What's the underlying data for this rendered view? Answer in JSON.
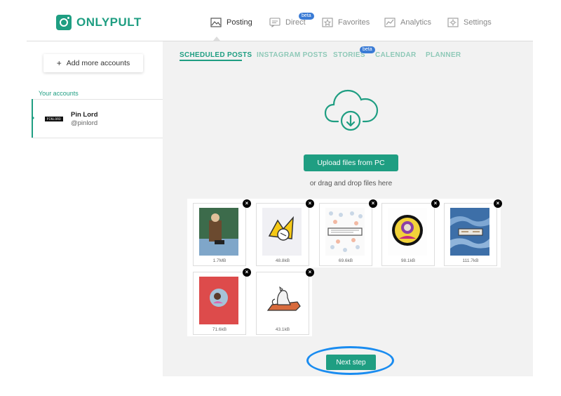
{
  "brand": {
    "name": "ONLYPULT",
    "color": "#1f9e82"
  },
  "nav": {
    "items": [
      {
        "label": "Posting",
        "icon": "image-icon",
        "active": true
      },
      {
        "label": "Direct",
        "icon": "chat-icon",
        "badge": "beta"
      },
      {
        "label": "Favorites",
        "icon": "star-icon"
      },
      {
        "label": "Analytics",
        "icon": "analytics-icon"
      },
      {
        "label": "Settings",
        "icon": "gear-icon"
      }
    ]
  },
  "sidebar": {
    "add_button": "Add more accounts",
    "section_label": "Your accounts",
    "account": {
      "name": "Pin Lord",
      "handle": "@pinlord",
      "avatar_text": "PINLORD"
    }
  },
  "tabs": [
    {
      "label": "SCHEDULED POSTS",
      "active": true
    },
    {
      "label": "INSTAGRAM POSTS"
    },
    {
      "label": "STORIES",
      "badge": "beta"
    },
    {
      "label": "CALENDAR"
    },
    {
      "label": "PLANNER"
    }
  ],
  "upload": {
    "button": "Upload files from PC",
    "hint": "or drag and drop files here",
    "icon": "cloud-download-icon"
  },
  "files": [
    {
      "size": "1.7MB"
    },
    {
      "size": "48.8kB"
    },
    {
      "size": "69.6kB"
    },
    {
      "size": "98.1kB"
    },
    {
      "size": "111.7kB"
    },
    {
      "size": "71.6kB"
    },
    {
      "size": "43.1kB"
    }
  ],
  "remove_glyph": "×",
  "next_button": "Next step",
  "highlight_color": "#1a8cf0"
}
